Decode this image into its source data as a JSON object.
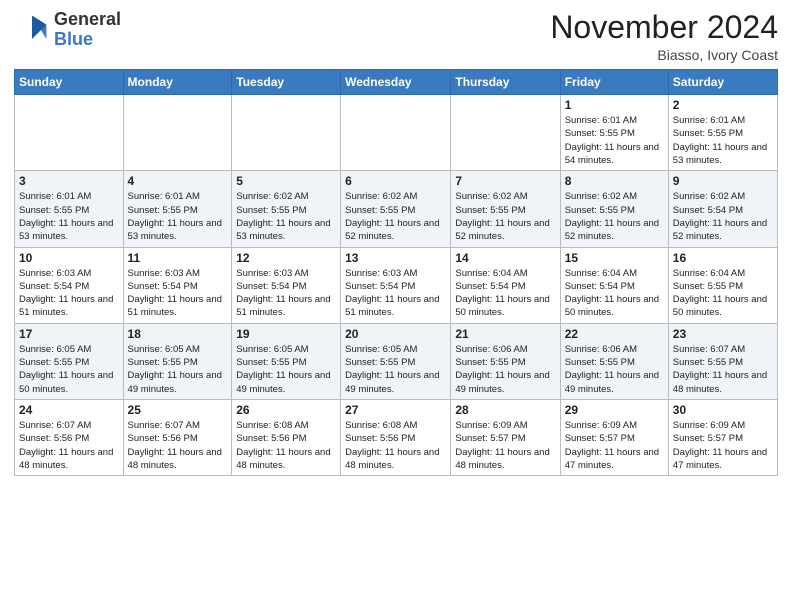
{
  "header": {
    "logo_general": "General",
    "logo_blue": "Blue",
    "month_title": "November 2024",
    "location": "Biasso, Ivory Coast"
  },
  "weekdays": [
    "Sunday",
    "Monday",
    "Tuesday",
    "Wednesday",
    "Thursday",
    "Friday",
    "Saturday"
  ],
  "weeks": [
    [
      {
        "day": "",
        "info": ""
      },
      {
        "day": "",
        "info": ""
      },
      {
        "day": "",
        "info": ""
      },
      {
        "day": "",
        "info": ""
      },
      {
        "day": "",
        "info": ""
      },
      {
        "day": "1",
        "info": "Sunrise: 6:01 AM\nSunset: 5:55 PM\nDaylight: 11 hours\nand 54 minutes."
      },
      {
        "day": "2",
        "info": "Sunrise: 6:01 AM\nSunset: 5:55 PM\nDaylight: 11 hours\nand 53 minutes."
      }
    ],
    [
      {
        "day": "3",
        "info": "Sunrise: 6:01 AM\nSunset: 5:55 PM\nDaylight: 11 hours\nand 53 minutes."
      },
      {
        "day": "4",
        "info": "Sunrise: 6:01 AM\nSunset: 5:55 PM\nDaylight: 11 hours\nand 53 minutes."
      },
      {
        "day": "5",
        "info": "Sunrise: 6:02 AM\nSunset: 5:55 PM\nDaylight: 11 hours\nand 53 minutes."
      },
      {
        "day": "6",
        "info": "Sunrise: 6:02 AM\nSunset: 5:55 PM\nDaylight: 11 hours\nand 52 minutes."
      },
      {
        "day": "7",
        "info": "Sunrise: 6:02 AM\nSunset: 5:55 PM\nDaylight: 11 hours\nand 52 minutes."
      },
      {
        "day": "8",
        "info": "Sunrise: 6:02 AM\nSunset: 5:55 PM\nDaylight: 11 hours\nand 52 minutes."
      },
      {
        "day": "9",
        "info": "Sunrise: 6:02 AM\nSunset: 5:54 PM\nDaylight: 11 hours\nand 52 minutes."
      }
    ],
    [
      {
        "day": "10",
        "info": "Sunrise: 6:03 AM\nSunset: 5:54 PM\nDaylight: 11 hours\nand 51 minutes."
      },
      {
        "day": "11",
        "info": "Sunrise: 6:03 AM\nSunset: 5:54 PM\nDaylight: 11 hours\nand 51 minutes."
      },
      {
        "day": "12",
        "info": "Sunrise: 6:03 AM\nSunset: 5:54 PM\nDaylight: 11 hours\nand 51 minutes."
      },
      {
        "day": "13",
        "info": "Sunrise: 6:03 AM\nSunset: 5:54 PM\nDaylight: 11 hours\nand 51 minutes."
      },
      {
        "day": "14",
        "info": "Sunrise: 6:04 AM\nSunset: 5:54 PM\nDaylight: 11 hours\nand 50 minutes."
      },
      {
        "day": "15",
        "info": "Sunrise: 6:04 AM\nSunset: 5:54 PM\nDaylight: 11 hours\nand 50 minutes."
      },
      {
        "day": "16",
        "info": "Sunrise: 6:04 AM\nSunset: 5:55 PM\nDaylight: 11 hours\nand 50 minutes."
      }
    ],
    [
      {
        "day": "17",
        "info": "Sunrise: 6:05 AM\nSunset: 5:55 PM\nDaylight: 11 hours\nand 50 minutes."
      },
      {
        "day": "18",
        "info": "Sunrise: 6:05 AM\nSunset: 5:55 PM\nDaylight: 11 hours\nand 49 minutes."
      },
      {
        "day": "19",
        "info": "Sunrise: 6:05 AM\nSunset: 5:55 PM\nDaylight: 11 hours\nand 49 minutes."
      },
      {
        "day": "20",
        "info": "Sunrise: 6:05 AM\nSunset: 5:55 PM\nDaylight: 11 hours\nand 49 minutes."
      },
      {
        "day": "21",
        "info": "Sunrise: 6:06 AM\nSunset: 5:55 PM\nDaylight: 11 hours\nand 49 minutes."
      },
      {
        "day": "22",
        "info": "Sunrise: 6:06 AM\nSunset: 5:55 PM\nDaylight: 11 hours\nand 49 minutes."
      },
      {
        "day": "23",
        "info": "Sunrise: 6:07 AM\nSunset: 5:55 PM\nDaylight: 11 hours\nand 48 minutes."
      }
    ],
    [
      {
        "day": "24",
        "info": "Sunrise: 6:07 AM\nSunset: 5:56 PM\nDaylight: 11 hours\nand 48 minutes."
      },
      {
        "day": "25",
        "info": "Sunrise: 6:07 AM\nSunset: 5:56 PM\nDaylight: 11 hours\nand 48 minutes."
      },
      {
        "day": "26",
        "info": "Sunrise: 6:08 AM\nSunset: 5:56 PM\nDaylight: 11 hours\nand 48 minutes."
      },
      {
        "day": "27",
        "info": "Sunrise: 6:08 AM\nSunset: 5:56 PM\nDaylight: 11 hours\nand 48 minutes."
      },
      {
        "day": "28",
        "info": "Sunrise: 6:09 AM\nSunset: 5:57 PM\nDaylight: 11 hours\nand 48 minutes."
      },
      {
        "day": "29",
        "info": "Sunrise: 6:09 AM\nSunset: 5:57 PM\nDaylight: 11 hours\nand 47 minutes."
      },
      {
        "day": "30",
        "info": "Sunrise: 6:09 AM\nSunset: 5:57 PM\nDaylight: 11 hours\nand 47 minutes."
      }
    ]
  ]
}
